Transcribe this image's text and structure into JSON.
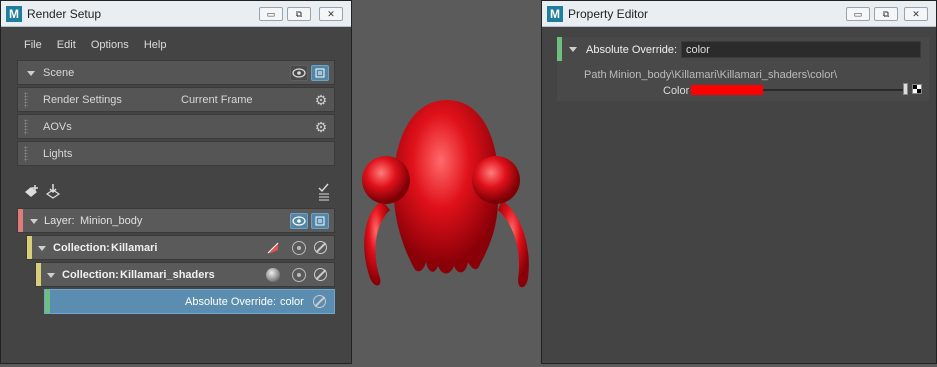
{
  "render_setup": {
    "title": "Render Setup",
    "menu": [
      "File",
      "Edit",
      "Options",
      "Help"
    ],
    "scene_label": "Scene",
    "render_settings_label": "Render Settings",
    "current_frame_label": "Current Frame",
    "aovs_label": "AOVs",
    "lights_label": "Lights",
    "layer": {
      "prefix": "Layer:",
      "name": "Minion_body",
      "strip_color": "#e07b7b"
    },
    "collection1": {
      "prefix": "Collection:",
      "name": "Killamari",
      "strip_color": "#d8cf78"
    },
    "collection2": {
      "prefix": "Collection:",
      "name": "Killamari_shaders",
      "strip_color": "#d8cf78"
    },
    "override": {
      "label": "Absolute Override:",
      "value": "color",
      "strip_color": "#6fbf7f",
      "bg": "#5a8db0"
    }
  },
  "property_editor": {
    "title": "Property Editor",
    "override_label": "Absolute Override:",
    "override_value": "color",
    "path_prefix": "Path",
    "path_value": "Minion_body\\Killamari\\Killamari_shaders\\color\\",
    "color_label": "Color",
    "swatch_color": "#ff0000",
    "strip_color": "#6fbf7f"
  },
  "window_buttons": {
    "minimize": "▭",
    "restore": "⧉",
    "close": "✕"
  },
  "viewport": {
    "background": "#5b5b5b",
    "model_color": "#e0111a"
  }
}
